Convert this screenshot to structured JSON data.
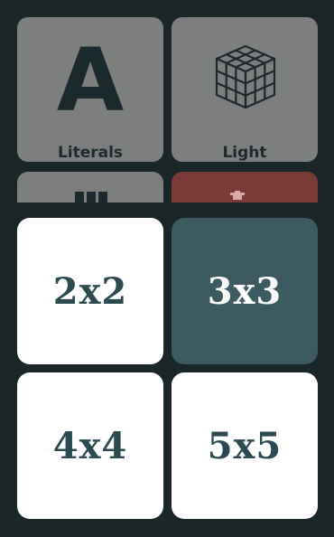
{
  "menu": {
    "tiles": [
      {
        "label": "Literals",
        "glyph": "A",
        "icon": "letter-a-icon"
      },
      {
        "label": "Light",
        "icon": "cube-icon"
      },
      {
        "label": "",
        "icon": "grid-icon"
      },
      {
        "label": "",
        "icon": "trash-icon"
      }
    ]
  },
  "size_picker": {
    "options": [
      {
        "label": "2x2",
        "selected": false
      },
      {
        "label": "3x3",
        "selected": true
      },
      {
        "label": "4x4",
        "selected": false
      },
      {
        "label": "5x5",
        "selected": false
      }
    ]
  },
  "colors": {
    "background": "#1b2629",
    "selected": "#3c5a60",
    "option": "#ffffff",
    "option_text": "#2c4a50",
    "dimmed_tile": "#7d7f7f",
    "dimmed_red_tile": "#7a3b38"
  }
}
